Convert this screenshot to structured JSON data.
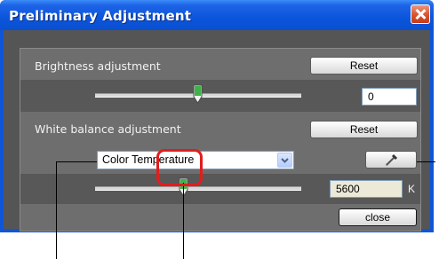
{
  "window": {
    "title": "Preliminary Adjustment"
  },
  "brightness": {
    "label": "Brightness adjustment",
    "reset_label": "Reset",
    "value": "0",
    "slider_fraction": 0.5
  },
  "white_balance": {
    "label": "White balance adjustment",
    "reset_label": "Reset",
    "mode_selected": "Color Temperature",
    "value": "5600",
    "unit": "K",
    "slider_fraction": 0.42,
    "eyedropper_icon": "eyedropper-icon"
  },
  "footer": {
    "close_label": "close"
  },
  "colors": {
    "title_bar": "#0b55dc",
    "panel": "#6e6e6e",
    "highlight": "#e11d1d"
  }
}
